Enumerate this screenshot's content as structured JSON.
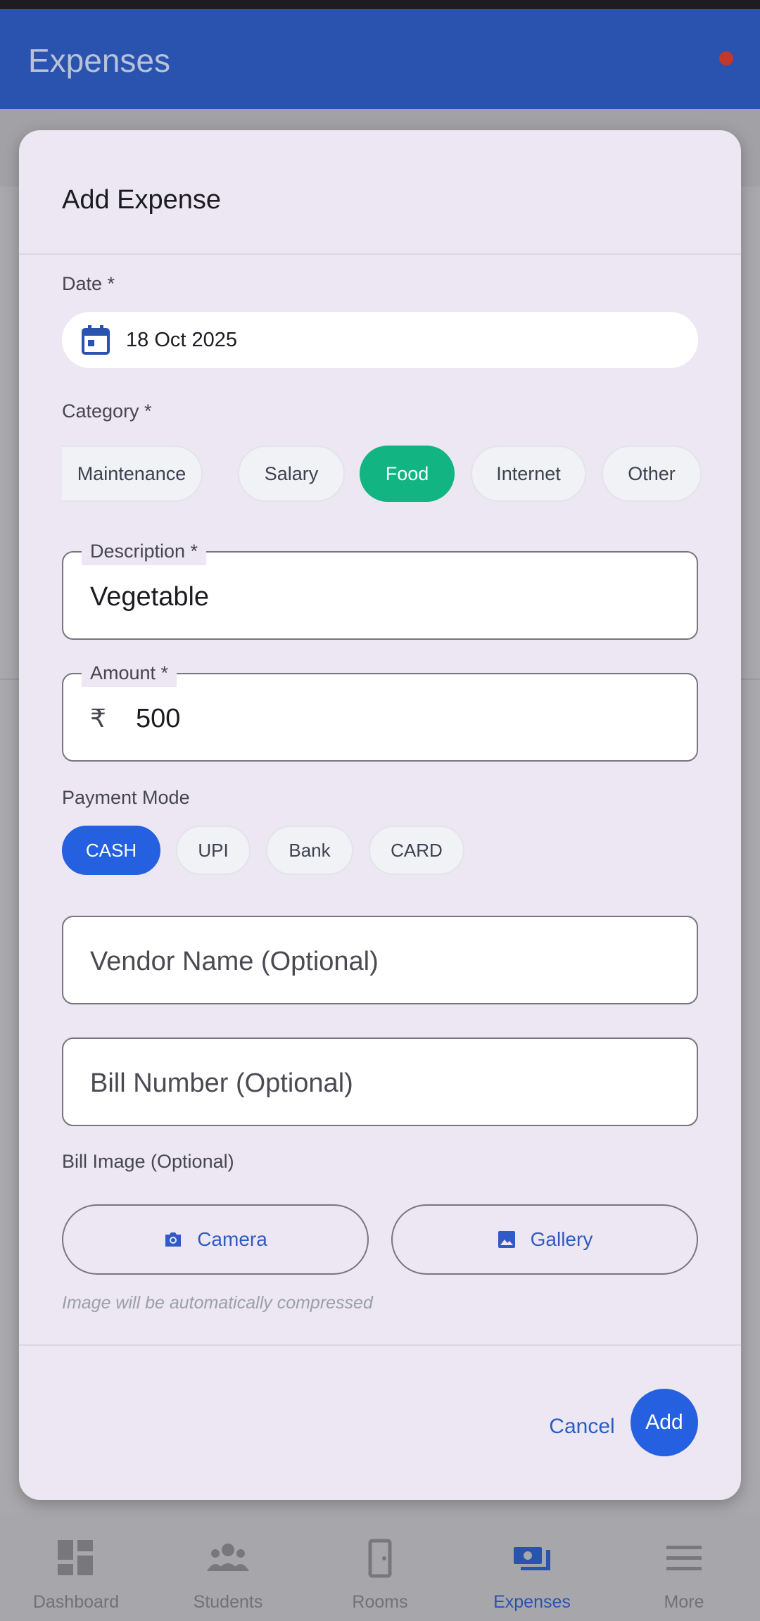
{
  "app_bar": {
    "title": "Expenses",
    "indicator_color": "#c0392b"
  },
  "dialog": {
    "title": "Add Expense",
    "date": {
      "label": "Date *",
      "value": "18 Oct 2025"
    },
    "category": {
      "label": "Category *",
      "options": [
        "Maintenance",
        "Salary",
        "Food",
        "Internet",
        "Other"
      ],
      "selected": "Food"
    },
    "description": {
      "label": "Description *",
      "value": "Vegetable"
    },
    "amount": {
      "label": "Amount *",
      "currency": "₹",
      "value": "500"
    },
    "payment_mode": {
      "label": "Payment Mode",
      "options": [
        "CASH",
        "UPI",
        "Bank",
        "CARD"
      ],
      "selected": "CASH"
    },
    "vendor": {
      "placeholder": "Vendor Name (Optional)"
    },
    "bill_number": {
      "placeholder": "Bill Number (Optional)"
    },
    "bill_image": {
      "label": "Bill Image (Optional)",
      "camera_label": "Camera",
      "gallery_label": "Gallery",
      "hint": "Image will be automatically compressed"
    },
    "actions": {
      "cancel": "Cancel",
      "add": "Add"
    }
  },
  "bottom_nav": {
    "items": [
      {
        "label": "Dashboard",
        "icon": "dashboard-icon"
      },
      {
        "label": "Students",
        "icon": "people-icon"
      },
      {
        "label": "Rooms",
        "icon": "door-icon"
      },
      {
        "label": "Expenses",
        "icon": "money-icon"
      },
      {
        "label": "More",
        "icon": "menu-icon"
      }
    ],
    "active": "Expenses"
  },
  "colors": {
    "primary": "#2a53b0",
    "selected_category": "#12b481",
    "selected_payment": "#2460e0",
    "dialog_bg": "#ece7f3"
  }
}
